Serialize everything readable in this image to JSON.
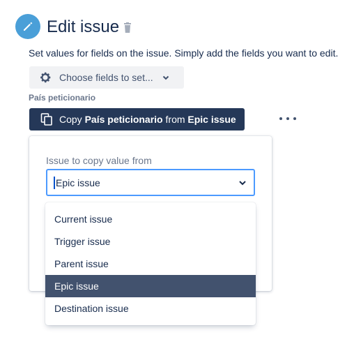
{
  "header": {
    "title": "Edit issue",
    "icon": "pencil-icon",
    "accent_color": "#4a9fd8"
  },
  "description": "Set values for fields on the issue. Simply add the fields you want to edit.",
  "choose_fields": {
    "label": "Choose fields to set..."
  },
  "field": {
    "label": "País peticionario",
    "copy_button": {
      "prefix": "Copy ",
      "field_name": "País peticionario",
      "middle": " from ",
      "source": "Epic issue"
    }
  },
  "panel": {
    "label": "Issue to copy value from",
    "select_value": "Epic issue"
  },
  "dropdown": {
    "options": [
      "Current issue",
      "Trigger issue",
      "Parent issue",
      "Epic issue",
      "Destination issue"
    ],
    "selected": "Epic issue"
  },
  "colors": {
    "copy_button_bg": "#253858",
    "selected_option_bg": "#42526e",
    "focus_border": "#4c9aff"
  }
}
